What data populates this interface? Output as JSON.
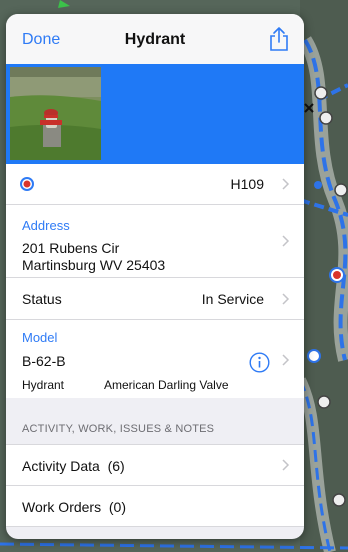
{
  "nav": {
    "done_label": "Done",
    "title": "Hydrant"
  },
  "feature": {
    "id": "H109",
    "status_color": "#d9342b"
  },
  "address": {
    "header": "Address",
    "line1": "201 Rubens Cir",
    "line2": "Martinsburg WV 25403"
  },
  "status": {
    "label": "Status",
    "value": "In Service"
  },
  "model": {
    "header": "Model",
    "value": "B-62-B",
    "type": "Hydrant",
    "manufacturer": "American Darling Valve"
  },
  "section": {
    "title": "ACTIVITY, WORK, ISSUES & NOTES"
  },
  "activity": {
    "label": "Activity Data",
    "count": "(6)"
  },
  "work_orders": {
    "label": "Work Orders",
    "count": "(0)"
  },
  "colors": {
    "accent": "#2f7bf5",
    "banner": "#1f79f6"
  }
}
